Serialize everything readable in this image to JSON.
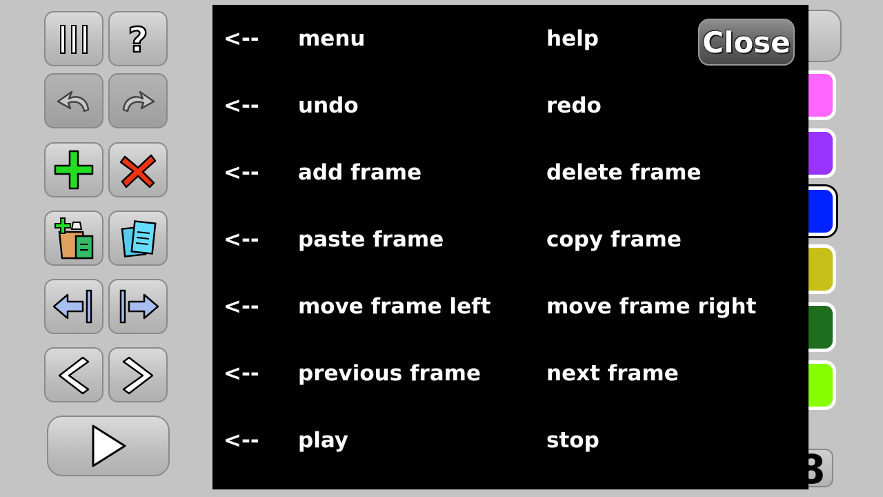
{
  "help_panel": {
    "close_label": "Close",
    "rows": [
      {
        "arrow": "<--",
        "left": "menu",
        "right": "help"
      },
      {
        "arrow": "<--",
        "left": "undo",
        "right": "redo"
      },
      {
        "arrow": "<--",
        "left": "add frame",
        "right": "delete frame"
      },
      {
        "arrow": "<--",
        "left": "paste frame",
        "right": "copy frame"
      },
      {
        "arrow": "<--",
        "left": "move frame left",
        "right": "move frame right"
      },
      {
        "arrow": "<--",
        "left": "previous frame",
        "right": "next frame"
      },
      {
        "arrow": "<--",
        "left": "play",
        "right": "stop"
      }
    ]
  },
  "toolbar": {
    "menu_icon": "menu-bars-icon",
    "help_glyph": "?",
    "icons": [
      "menu-bars-icon",
      "question-mark-icon",
      "undo-icon",
      "redo-icon",
      "plus-icon",
      "x-icon",
      "paste-frame-icon",
      "copy-frame-icon",
      "move-left-icon",
      "move-right-icon",
      "chevron-left-icon",
      "chevron-right-icon",
      "play-icon"
    ]
  },
  "palette": {
    "colors": [
      "#ff66ff",
      "#9933ff",
      "#0022ff",
      "#c8c01a",
      "#1e6e1e",
      "#88ff00"
    ],
    "selected_index": 2
  },
  "frame_counter": {
    "value": "8"
  }
}
